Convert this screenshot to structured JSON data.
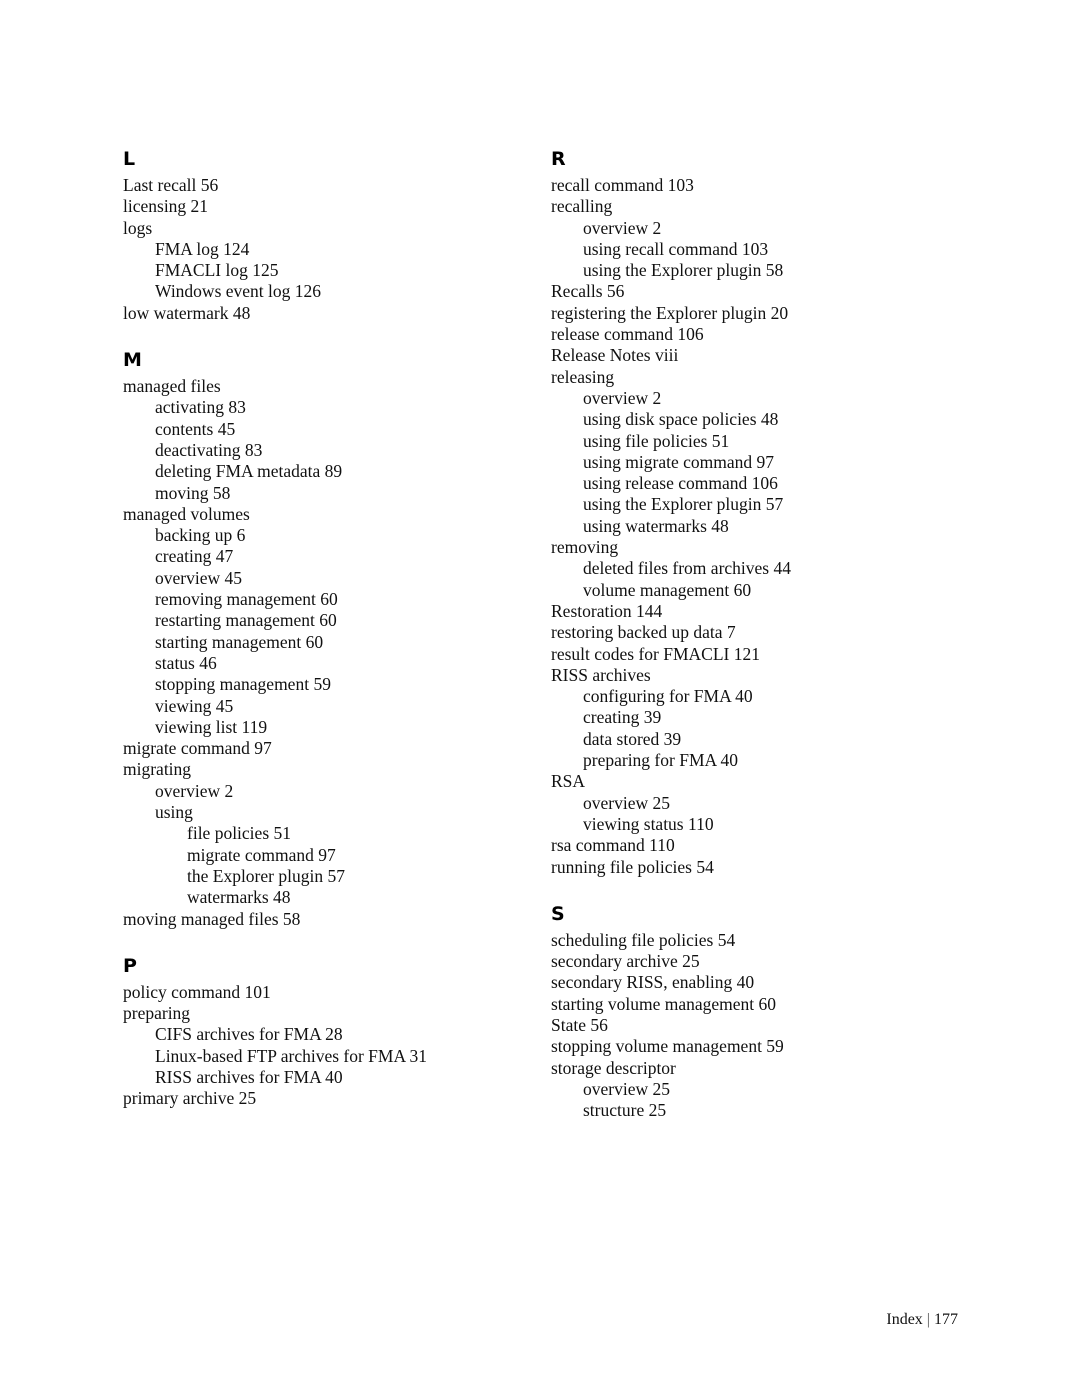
{
  "page": {
    "footer_label": "Index",
    "footer_separator": "|",
    "footer_page_number": "177"
  },
  "columns": [
    {
      "name": "left",
      "groups": [
        {
          "letter": "L",
          "entries": [
            {
              "level": 0,
              "text": "Last recall 56"
            },
            {
              "level": 0,
              "text": "licensing 21"
            },
            {
              "level": 0,
              "text": "logs"
            },
            {
              "level": 1,
              "text": "FMA log 124"
            },
            {
              "level": 1,
              "text": "FMACLI log 125"
            },
            {
              "level": 1,
              "text": "Windows event log 126"
            },
            {
              "level": 0,
              "text": "low watermark 48"
            }
          ]
        },
        {
          "letter": "M",
          "entries": [
            {
              "level": 0,
              "text": "managed files"
            },
            {
              "level": 1,
              "text": "activating 83"
            },
            {
              "level": 1,
              "text": "contents 45"
            },
            {
              "level": 1,
              "text": "deactivating 83"
            },
            {
              "level": 1,
              "text": "deleting FMA metadata 89"
            },
            {
              "level": 1,
              "text": "moving 58"
            },
            {
              "level": 0,
              "text": "managed volumes"
            },
            {
              "level": 1,
              "text": "backing up 6"
            },
            {
              "level": 1,
              "text": "creating 47"
            },
            {
              "level": 1,
              "text": "overview 45"
            },
            {
              "level": 1,
              "text": "removing management 60"
            },
            {
              "level": 1,
              "text": "restarting management 60"
            },
            {
              "level": 1,
              "text": "starting management 60"
            },
            {
              "level": 1,
              "text": "status 46"
            },
            {
              "level": 1,
              "text": "stopping management 59"
            },
            {
              "level": 1,
              "text": "viewing 45"
            },
            {
              "level": 1,
              "text": "viewing list 119"
            },
            {
              "level": 0,
              "text": "migrate command 97"
            },
            {
              "level": 0,
              "text": "migrating"
            },
            {
              "level": 1,
              "text": "overview 2"
            },
            {
              "level": 1,
              "text": "using"
            },
            {
              "level": 2,
              "text": "file policies 51"
            },
            {
              "level": 2,
              "text": "migrate command 97"
            },
            {
              "level": 2,
              "text": "the Explorer plugin 57"
            },
            {
              "level": 2,
              "text": "watermarks 48"
            },
            {
              "level": 0,
              "text": "moving managed files 58"
            }
          ]
        },
        {
          "letter": "P",
          "entries": [
            {
              "level": 0,
              "text": "policy command 101"
            },
            {
              "level": 0,
              "text": "preparing"
            },
            {
              "level": 1,
              "text": "CIFS archives for FMA 28"
            },
            {
              "level": 1,
              "text": "Linux-based FTP archives for FMA 31"
            },
            {
              "level": 1,
              "text": "RISS archives for FMA 40"
            },
            {
              "level": 0,
              "text": "primary archive 25"
            }
          ]
        }
      ]
    },
    {
      "name": "right",
      "groups": [
        {
          "letter": "R",
          "entries": [
            {
              "level": 0,
              "text": "recall command 103"
            },
            {
              "level": 0,
              "text": "recalling"
            },
            {
              "level": 1,
              "text": "overview 2"
            },
            {
              "level": 1,
              "text": "using recall command 103"
            },
            {
              "level": 1,
              "text": "using the Explorer plugin 58"
            },
            {
              "level": 0,
              "text": "Recalls 56"
            },
            {
              "level": 0,
              "text": "registering the Explorer plugin 20"
            },
            {
              "level": 0,
              "text": "release command 106"
            },
            {
              "level": 0,
              "text": "Release Notes viii"
            },
            {
              "level": 0,
              "text": "releasing"
            },
            {
              "level": 1,
              "text": "overview 2"
            },
            {
              "level": 1,
              "text": "using disk space policies 48"
            },
            {
              "level": 1,
              "text": "using file policies 51"
            },
            {
              "level": 1,
              "text": "using migrate command 97"
            },
            {
              "level": 1,
              "text": "using release command 106"
            },
            {
              "level": 1,
              "text": "using the Explorer plugin 57"
            },
            {
              "level": 1,
              "text": "using watermarks 48"
            },
            {
              "level": 0,
              "text": "removing"
            },
            {
              "level": 1,
              "text": "deleted files from archives 44"
            },
            {
              "level": 1,
              "text": "volume management 60"
            },
            {
              "level": 0,
              "text": "Restoration 144"
            },
            {
              "level": 0,
              "text": "restoring backed up data 7"
            },
            {
              "level": 0,
              "text": "result codes for FMACLI 121"
            },
            {
              "level": 0,
              "text": "RISS archives"
            },
            {
              "level": 1,
              "text": "configuring for FMA 40"
            },
            {
              "level": 1,
              "text": "creating 39"
            },
            {
              "level": 1,
              "text": "data stored 39"
            },
            {
              "level": 1,
              "text": "preparing for FMA 40"
            },
            {
              "level": 0,
              "text": "RSA"
            },
            {
              "level": 1,
              "text": "overview 25"
            },
            {
              "level": 1,
              "text": "viewing status 110"
            },
            {
              "level": 0,
              "text": "rsa command 110"
            },
            {
              "level": 0,
              "text": "running file policies 54"
            }
          ]
        },
        {
          "letter": "S",
          "entries": [
            {
              "level": 0,
              "text": "scheduling file policies 54"
            },
            {
              "level": 0,
              "text": "secondary archive 25"
            },
            {
              "level": 0,
              "text": "secondary RISS, enabling 40"
            },
            {
              "level": 0,
              "text": "starting volume management 60"
            },
            {
              "level": 0,
              "text": "State 56"
            },
            {
              "level": 0,
              "text": "stopping volume management 59"
            },
            {
              "level": 0,
              "text": "storage descriptor"
            },
            {
              "level": 1,
              "text": "overview 25"
            },
            {
              "level": 1,
              "text": "structure 25"
            }
          ]
        }
      ]
    }
  ]
}
